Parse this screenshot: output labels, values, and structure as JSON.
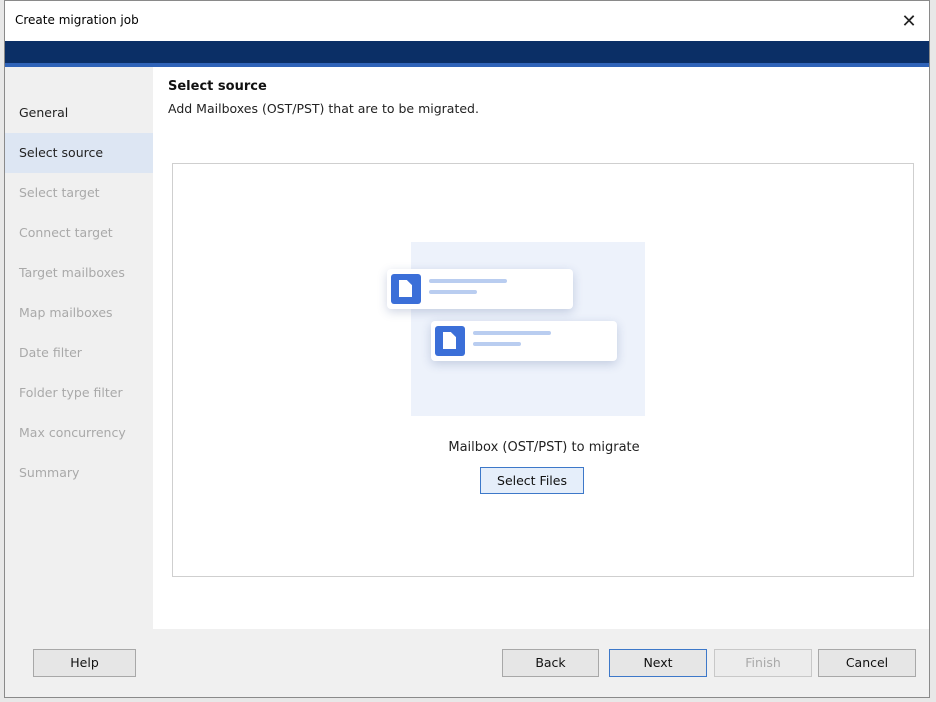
{
  "window": {
    "title": "Create migration job",
    "close_symbol": "✕"
  },
  "sidebar": {
    "items": [
      {
        "label": "General",
        "state": "normal"
      },
      {
        "label": "Select source",
        "state": "active"
      },
      {
        "label": "Select target",
        "state": "disabled"
      },
      {
        "label": "Connect target",
        "state": "disabled"
      },
      {
        "label": "Target mailboxes",
        "state": "disabled"
      },
      {
        "label": "Map mailboxes",
        "state": "disabled"
      },
      {
        "label": "Date filter",
        "state": "disabled"
      },
      {
        "label": "Folder type filter",
        "state": "disabled"
      },
      {
        "label": "Max concurrency",
        "state": "disabled"
      },
      {
        "label": "Summary",
        "state": "disabled"
      }
    ]
  },
  "main": {
    "heading": "Select source",
    "subheading": "Add Mailboxes (OST/PST) that are to be migrated.",
    "panel": {
      "caption": "Mailbox (OST/PST) to migrate",
      "select_files_label": "Select Files",
      "illustration_icons": [
        "document-icon",
        "document-icon"
      ]
    }
  },
  "footer": {
    "help_label": "Help",
    "back_label": "Back",
    "next_label": "Next",
    "finish_label": "Finish",
    "cancel_label": "Cancel"
  },
  "colors": {
    "banner": "#0b2f66",
    "accent": "#3b6fd8",
    "active_nav_bg": "#dde6f3"
  }
}
